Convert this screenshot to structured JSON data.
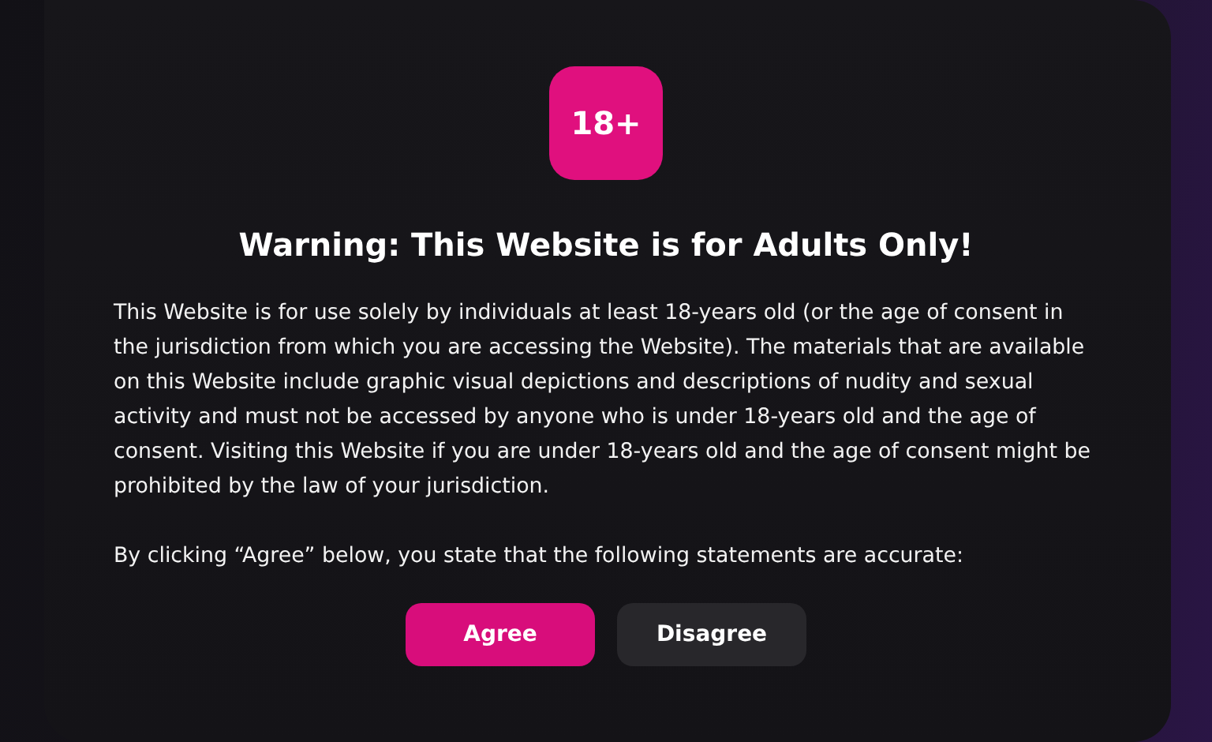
{
  "badge": "18+",
  "title": "Warning: This Website is for Adults Only!",
  "paragraphs": [
    "This Website is for use solely by individuals at least 18-years old (or the age of consent in the jurisdiction from which you are accessing the Website). The materials that are available on this Website include graphic visual depictions and descriptions of nudity and sexual activity and must not be accessed by anyone who is under 18-years old and the age of consent. Visiting this Website if you are under 18-years old and the age of consent might be prohibited by the law of your jurisdiction.",
    "By clicking “Agree” below, you state that the following statements are accurate:"
  ],
  "buttons": [
    {
      "label": "Agree",
      "kind": "primary"
    },
    {
      "label": "Disagree",
      "kind": "secondary"
    }
  ]
}
